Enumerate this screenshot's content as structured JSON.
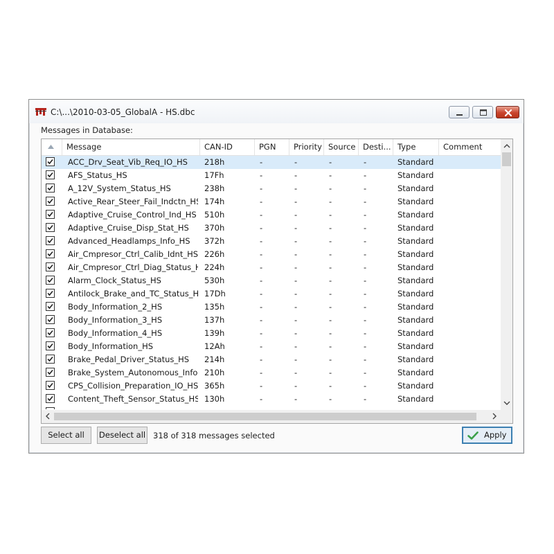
{
  "window": {
    "title": "C:\\...\\2010-03-05_GlobalA - HS.dbc",
    "section_label": "Messages in Database:"
  },
  "columns": [
    "Message",
    "CAN-ID",
    "PGN",
    "Priority",
    "Source",
    "Desti...",
    "Type",
    "Comment"
  ],
  "rows": [
    {
      "checked": true,
      "selected": true,
      "message": "ACC_Drv_Seat_Vib_Req_IO_HS",
      "can_id": "218h",
      "pgn": "-",
      "priority": "-",
      "source": "-",
      "dest": "-",
      "type": "Standard",
      "comment": ""
    },
    {
      "checked": true,
      "message": "AFS_Status_HS",
      "can_id": "17Fh",
      "pgn": "-",
      "priority": "-",
      "source": "-",
      "dest": "-",
      "type": "Standard",
      "comment": ""
    },
    {
      "checked": true,
      "message": "A_12V_System_Status_HS",
      "can_id": "238h",
      "pgn": "-",
      "priority": "-",
      "source": "-",
      "dest": "-",
      "type": "Standard",
      "comment": ""
    },
    {
      "checked": true,
      "message": "Active_Rear_Steer_Fail_Indctn_HS",
      "can_id": "174h",
      "pgn": "-",
      "priority": "-",
      "source": "-",
      "dest": "-",
      "type": "Standard",
      "comment": ""
    },
    {
      "checked": true,
      "message": "Adaptive_Cruise_Control_Ind_HS",
      "can_id": "510h",
      "pgn": "-",
      "priority": "-",
      "source": "-",
      "dest": "-",
      "type": "Standard",
      "comment": ""
    },
    {
      "checked": true,
      "message": "Adaptive_Cruise_Disp_Stat_HS",
      "can_id": "370h",
      "pgn": "-",
      "priority": "-",
      "source": "-",
      "dest": "-",
      "type": "Standard",
      "comment": ""
    },
    {
      "checked": true,
      "message": "Advanced_Headlamps_Info_HS",
      "can_id": "372h",
      "pgn": "-",
      "priority": "-",
      "source": "-",
      "dest": "-",
      "type": "Standard",
      "comment": ""
    },
    {
      "checked": true,
      "message": "Air_Cmpresor_Ctrl_Calib_Idnt_HS",
      "can_id": "226h",
      "pgn": "-",
      "priority": "-",
      "source": "-",
      "dest": "-",
      "type": "Standard",
      "comment": ""
    },
    {
      "checked": true,
      "message": "Air_Cmpresor_Ctrl_Diag_Status_HS",
      "can_id": "224h",
      "pgn": "-",
      "priority": "-",
      "source": "-",
      "dest": "-",
      "type": "Standard",
      "comment": ""
    },
    {
      "checked": true,
      "message": "Alarm_Clock_Status_HS",
      "can_id": "530h",
      "pgn": "-",
      "priority": "-",
      "source": "-",
      "dest": "-",
      "type": "Standard",
      "comment": ""
    },
    {
      "checked": true,
      "message": "Antilock_Brake_and_TC_Status_HS",
      "can_id": "17Dh",
      "pgn": "-",
      "priority": "-",
      "source": "-",
      "dest": "-",
      "type": "Standard",
      "comment": ""
    },
    {
      "checked": true,
      "message": "Body_Information_2_HS",
      "can_id": "135h",
      "pgn": "-",
      "priority": "-",
      "source": "-",
      "dest": "-",
      "type": "Standard",
      "comment": ""
    },
    {
      "checked": true,
      "message": "Body_Information_3_HS",
      "can_id": "137h",
      "pgn": "-",
      "priority": "-",
      "source": "-",
      "dest": "-",
      "type": "Standard",
      "comment": ""
    },
    {
      "checked": true,
      "message": "Body_Information_4_HS",
      "can_id": "139h",
      "pgn": "-",
      "priority": "-",
      "source": "-",
      "dest": "-",
      "type": "Standard",
      "comment": ""
    },
    {
      "checked": true,
      "message": "Body_Information_HS",
      "can_id": "12Ah",
      "pgn": "-",
      "priority": "-",
      "source": "-",
      "dest": "-",
      "type": "Standard",
      "comment": ""
    },
    {
      "checked": true,
      "message": "Brake_Pedal_Driver_Status_HS",
      "can_id": "214h",
      "pgn": "-",
      "priority": "-",
      "source": "-",
      "dest": "-",
      "type": "Standard",
      "comment": ""
    },
    {
      "checked": true,
      "message": "Brake_System_Autonomous_Info...",
      "can_id": "210h",
      "pgn": "-",
      "priority": "-",
      "source": "-",
      "dest": "-",
      "type": "Standard",
      "comment": ""
    },
    {
      "checked": true,
      "message": "CPS_Collision_Preparation_IO_HS",
      "can_id": "365h",
      "pgn": "-",
      "priority": "-",
      "source": "-",
      "dest": "-",
      "type": "Standard",
      "comment": ""
    },
    {
      "checked": true,
      "message": "Content_Theft_Sensor_Status_HS",
      "can_id": "130h",
      "pgn": "-",
      "priority": "-",
      "source": "-",
      "dest": "-",
      "type": "Standard",
      "comment": ""
    }
  ],
  "footer": {
    "select_all": "Select all",
    "deselect_all": "Deselect all",
    "status": "318 of 318 messages selected",
    "apply": "Apply"
  },
  "icons": {
    "app": "vector-app-icon",
    "minimize": "minimize-icon",
    "maximize": "maximize-icon",
    "close": "close-icon",
    "sort": "sort-ascending-icon",
    "apply": "checkmark-icon"
  },
  "colors": {
    "selected_row": "#d9ebfa",
    "apply_border": "#3c7fb1",
    "apply_check": "#3aa04a",
    "close_button": "#c9452d"
  }
}
